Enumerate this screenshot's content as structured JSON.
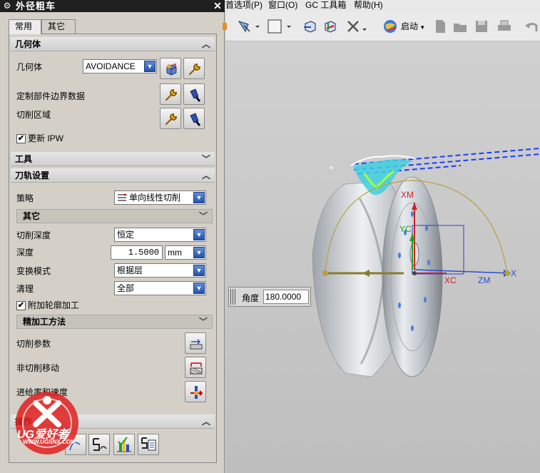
{
  "dialog": {
    "title": "外径粗车",
    "tabs": [
      {
        "label": "常用"
      },
      {
        "label": "其它"
      }
    ],
    "geometry_section": {
      "title": "几何体",
      "geometry_label": "几何体",
      "geometry_value": "AVOIDANCE",
      "custom_boundary_label": "定制部件边界数据",
      "cut_region_label": "切削区域",
      "update_ipw_label": "更新 IPW",
      "update_ipw_checked": true
    },
    "tools_section": {
      "title": "工具"
    },
    "path_section": {
      "title": "刀轨设置",
      "strategy_label": "策略",
      "strategy_value": "单向线性切削",
      "other_subsection": "其它",
      "cut_depth_label": "切削深度",
      "cut_depth_value": "恒定",
      "depth_label": "深度",
      "depth_value": "1.5000",
      "depth_unit": "mm",
      "transform_mode_label": "变换模式",
      "transform_mode_value": "根据层",
      "cleanup_label": "清理",
      "cleanup_value": "全部",
      "extra_contour_label": "附加轮廓加工",
      "extra_contour_checked": true,
      "finish_subsection": "精加工方法",
      "cut_params_label": "切削参数",
      "non_cut_moves_label": "非切削移动",
      "feeds_speeds_label": "进给率和速度"
    },
    "operations_section": {
      "title": "操作"
    }
  },
  "menubar": {
    "items": [
      "首选项(P)",
      "窗口(O)",
      "GC 工具箱",
      "帮助(H)"
    ]
  },
  "toolbar": {
    "start_label": "启动"
  },
  "viewport": {
    "angle_label": "角度",
    "angle_value": "180.0000",
    "axis_labels": {
      "xm": "XM",
      "yc": "YC",
      "xc": "XC",
      "zm": "ZM",
      "x": "X"
    },
    "plus_marker": "+"
  },
  "watermark": {
    "brand": "UG爱好者",
    "url": "WWW.UGSNX.COM"
  }
}
